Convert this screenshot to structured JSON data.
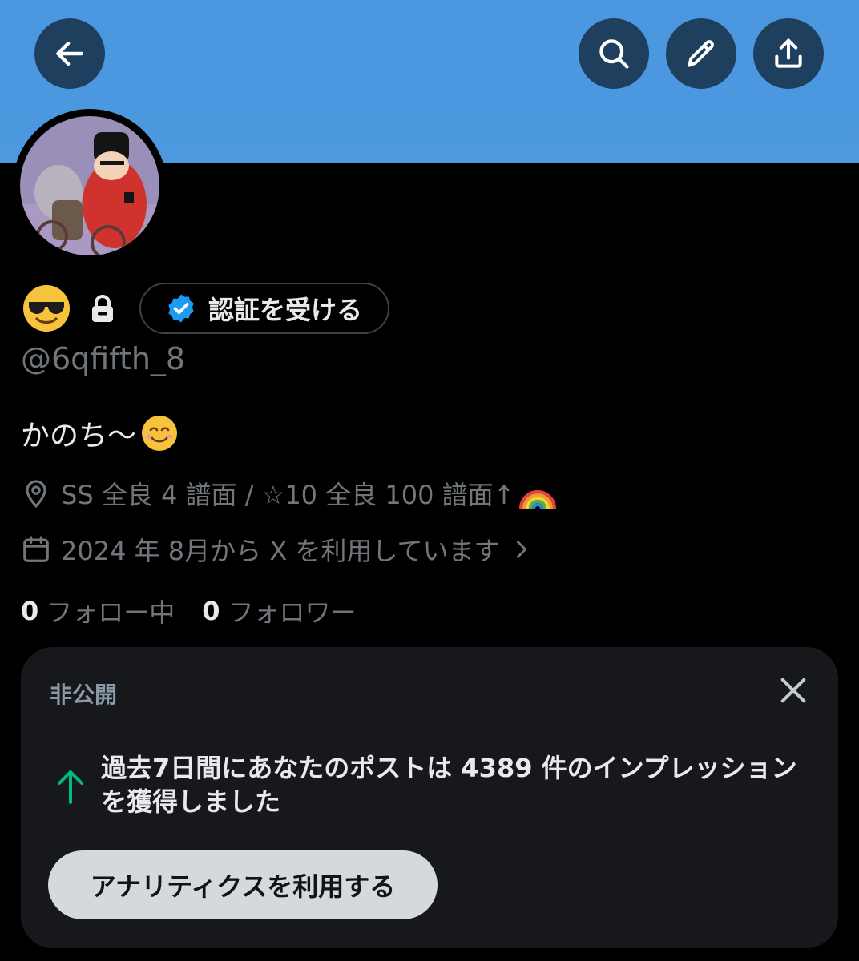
{
  "header": {
    "back_icon": "arrow-left-icon",
    "search_icon": "search-icon",
    "edit_icon": "pencil-icon",
    "share_icon": "share-upload-icon",
    "banner_color": "#4a97e0"
  },
  "profile": {
    "display_name_emoji": "sunglasses-emoji",
    "protected_icon": "lock-icon",
    "verify_button": "認証を受ける",
    "handle": "@6qfifth_8",
    "bio": "かのち〜",
    "location": "SS 全良 4 譜面 / ☆10 全良 100 譜面↑",
    "joined": "2024 年 8月から X を利用しています",
    "following_count": "0",
    "following_label": "フォロー中",
    "followers_count": "0",
    "followers_label": "フォロワー"
  },
  "insight_card": {
    "label": "非公開",
    "message": "過去7日間にあなたのポストは 4389 件のインプレッションを獲得しました",
    "button": "アナリティクスを利用する",
    "accent_color": "#00ba7c"
  }
}
